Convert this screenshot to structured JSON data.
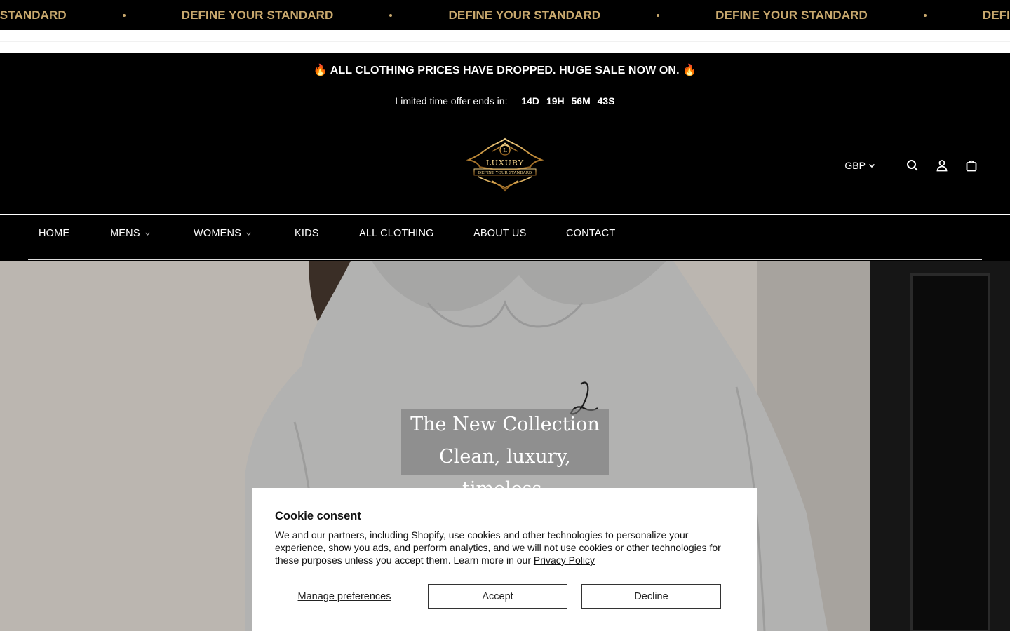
{
  "marquee": {
    "items": [
      "DEFINE YOUR STANDARD",
      "DEFINE YOUR STANDARD",
      "DEFINE YOUR STANDARD",
      "DEFINE YOUR STANDARD",
      "DEFINE YOUR STANDARD"
    ],
    "color": "#c9a96e"
  },
  "announcement": {
    "title": "🔥 ALL CLOTHING PRICES HAVE DROPPED. HUGE SALE NOW ON. 🔥",
    "countdown_label": "Limited time offer ends in:",
    "days": "14D",
    "hours": "19H",
    "minutes": "56M",
    "seconds": "43S"
  },
  "logo": {
    "text": "LUXURY",
    "tagline": "DEFINE YOUR STANDARD",
    "mark": "L"
  },
  "header": {
    "currency": "GBP",
    "icons": [
      "search-icon",
      "account-icon",
      "cart-icon"
    ]
  },
  "nav": {
    "items": [
      {
        "label": "HOME"
      },
      {
        "label": "MENS"
      },
      {
        "label": "WOMENS"
      },
      {
        "label": "KIDS"
      },
      {
        "label": "ALL CLOTHING"
      },
      {
        "label": "ABOUT US"
      },
      {
        "label": "CONTACT"
      }
    ]
  },
  "hero": {
    "title": "The New Collection",
    "subtitle": "Clean, luxury, timeless."
  },
  "cookie": {
    "title": "Cookie consent",
    "body": "We and our partners, including Shopify, use cookies and other technologies to personalize your experience, show you ads, and perform analytics, and we will not use cookies or other technologies for these purposes unless you accept them. Learn more in our ",
    "link": "Privacy Policy",
    "manage": "Manage preferences",
    "accept": "Accept",
    "decline": "Decline"
  }
}
